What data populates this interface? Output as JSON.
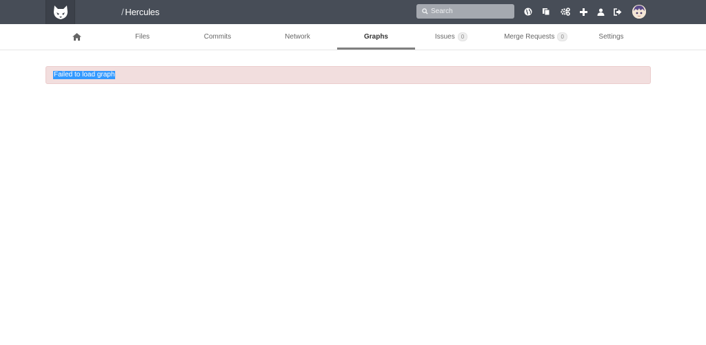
{
  "header": {
    "project_separator": "/",
    "project_name": "Hercules",
    "search_placeholder": "Search",
    "icons": [
      "logo-icon",
      "globe-icon",
      "copy-icon",
      "gears-icon",
      "plus-icon",
      "user-icon",
      "sign-out-icon",
      "avatar"
    ]
  },
  "nav": {
    "tabs": [
      {
        "label": "",
        "icon": "home-icon"
      },
      {
        "label": "Files"
      },
      {
        "label": "Commits"
      },
      {
        "label": "Network"
      },
      {
        "label": "Graphs",
        "active": true
      },
      {
        "label": "Issues",
        "count": "0"
      },
      {
        "label": "Merge Requests",
        "count": "0"
      },
      {
        "label": "Settings"
      }
    ]
  },
  "alert": {
    "message": "Failed to load graph"
  },
  "colors": {
    "topbar": "#474d57",
    "alert_bg": "#f2dede",
    "selection": "#3399ff"
  }
}
